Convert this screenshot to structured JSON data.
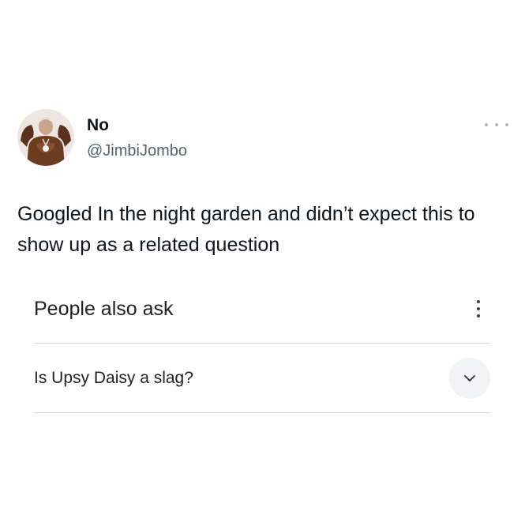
{
  "tweet": {
    "display_name": "No",
    "handle": "@JimbiJombo",
    "text": "Googled In the night garden and didn’t expect this to show up as a related question",
    "more_icon": "more-horizontal-icon",
    "avatar_icon": "avatar-bodybuilder"
  },
  "google_card": {
    "section_title": "People also ask",
    "menu_icon": "more-vertical-icon",
    "questions": [
      {
        "text": "Is Upsy Daisy a slag?",
        "icon": "chevron-down-icon"
      }
    ]
  },
  "colors": {
    "name_text": "#0f1419",
    "handle_text": "#536471",
    "google_text": "#202124",
    "divider": "#dadce0",
    "chevron_bg": "#f1f3f4"
  }
}
